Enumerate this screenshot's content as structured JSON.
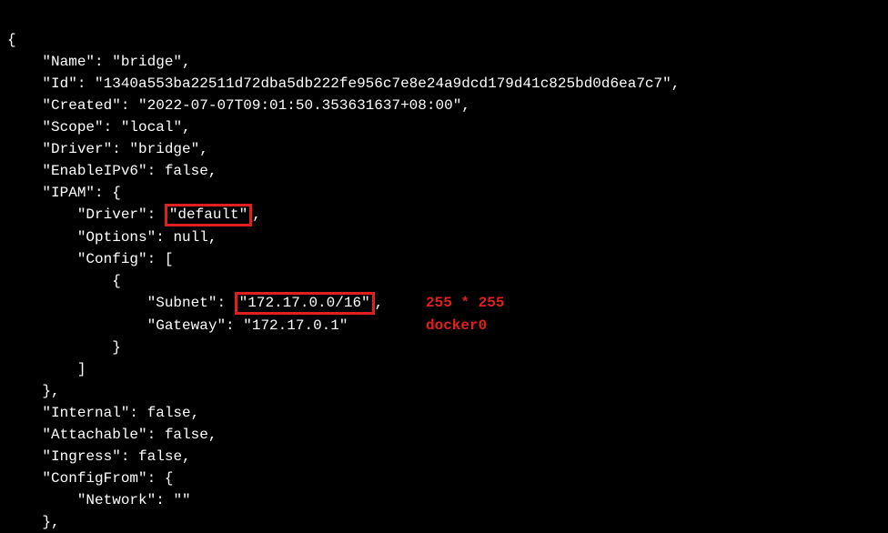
{
  "json": {
    "open": "{",
    "name_key": "    \"Name\": ",
    "name_val": "\"bridge\",",
    "id_key": "    \"Id\": ",
    "id_val": "\"1340a553ba22511d72dba5db222fe956c7e8e24a9dcd179d41c825bd0d6ea7c7\",",
    "created_key": "    \"Created\": ",
    "created_val": "\"2022-07-07T09:01:50.353631637+08:00\",",
    "scope_key": "    \"Scope\": ",
    "scope_val": "\"local\",",
    "driver_key": "    \"Driver\": ",
    "driver_val": "\"bridge\",",
    "enableipv6_key": "    \"EnableIPv6\": ",
    "enableipv6_val": "false,",
    "ipam_key": "    \"IPAM\": {",
    "ipam_driver_key": "        \"Driver\": ",
    "ipam_driver_val": "\"default\"",
    "ipam_driver_comma": ",",
    "ipam_options_key": "        \"Options\": ",
    "ipam_options_val": "null,",
    "ipam_config_key": "        \"Config\": [",
    "ipam_config_open": "            {",
    "subnet_key": "                \"Subnet\": ",
    "subnet_val": "\"172.17.0.0/16\"",
    "subnet_comma": ",",
    "gateway_key": "                \"Gateway\": ",
    "gateway_val": "\"172.17.0.1\"",
    "ipam_config_close": "            }",
    "ipam_config_arr_close": "        ]",
    "ipam_close": "    },",
    "internal_key": "    \"Internal\": ",
    "internal_val": "false,",
    "attachable_key": "    \"Attachable\": ",
    "attachable_val": "false,",
    "ingress_key": "    \"Ingress\": ",
    "ingress_val": "false,",
    "configfrom_key": "    \"ConfigFrom\": {",
    "configfrom_network_key": "        \"Network\": ",
    "configfrom_network_val": "\"\"",
    "configfrom_close": "    },"
  },
  "annotations": {
    "subnet_note": "255 * 255",
    "gateway_note": "docker0"
  }
}
